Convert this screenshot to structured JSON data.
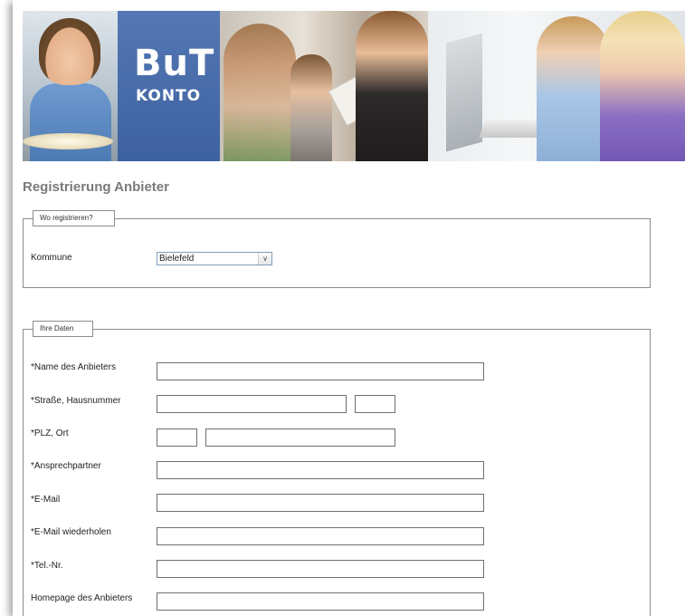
{
  "banner": {
    "logo_main": "BuT",
    "logo_sub": "KONTO"
  },
  "page": {
    "title": "Registrierung Anbieter"
  },
  "section_where": {
    "legend": "Wo registrieren?",
    "kommune_label": "Kommune",
    "kommune_value": "Bielefeld"
  },
  "section_data": {
    "legend": "Ihre Daten",
    "fields": {
      "name_label": "*Name des Anbieters",
      "street_label": "*Straße, Hausnummer",
      "plz_label": "*PLZ, Ort",
      "contact_label": "*Ansprechpartner",
      "email_label": "*E-Mail",
      "email_repeat_label": "*E-Mail wiederholen",
      "phone_label": "*Tel.-Nr.",
      "homepage_label": "Homepage des Anbieters"
    }
  },
  "icons": {
    "dropdown": "chevron-down-icon"
  }
}
